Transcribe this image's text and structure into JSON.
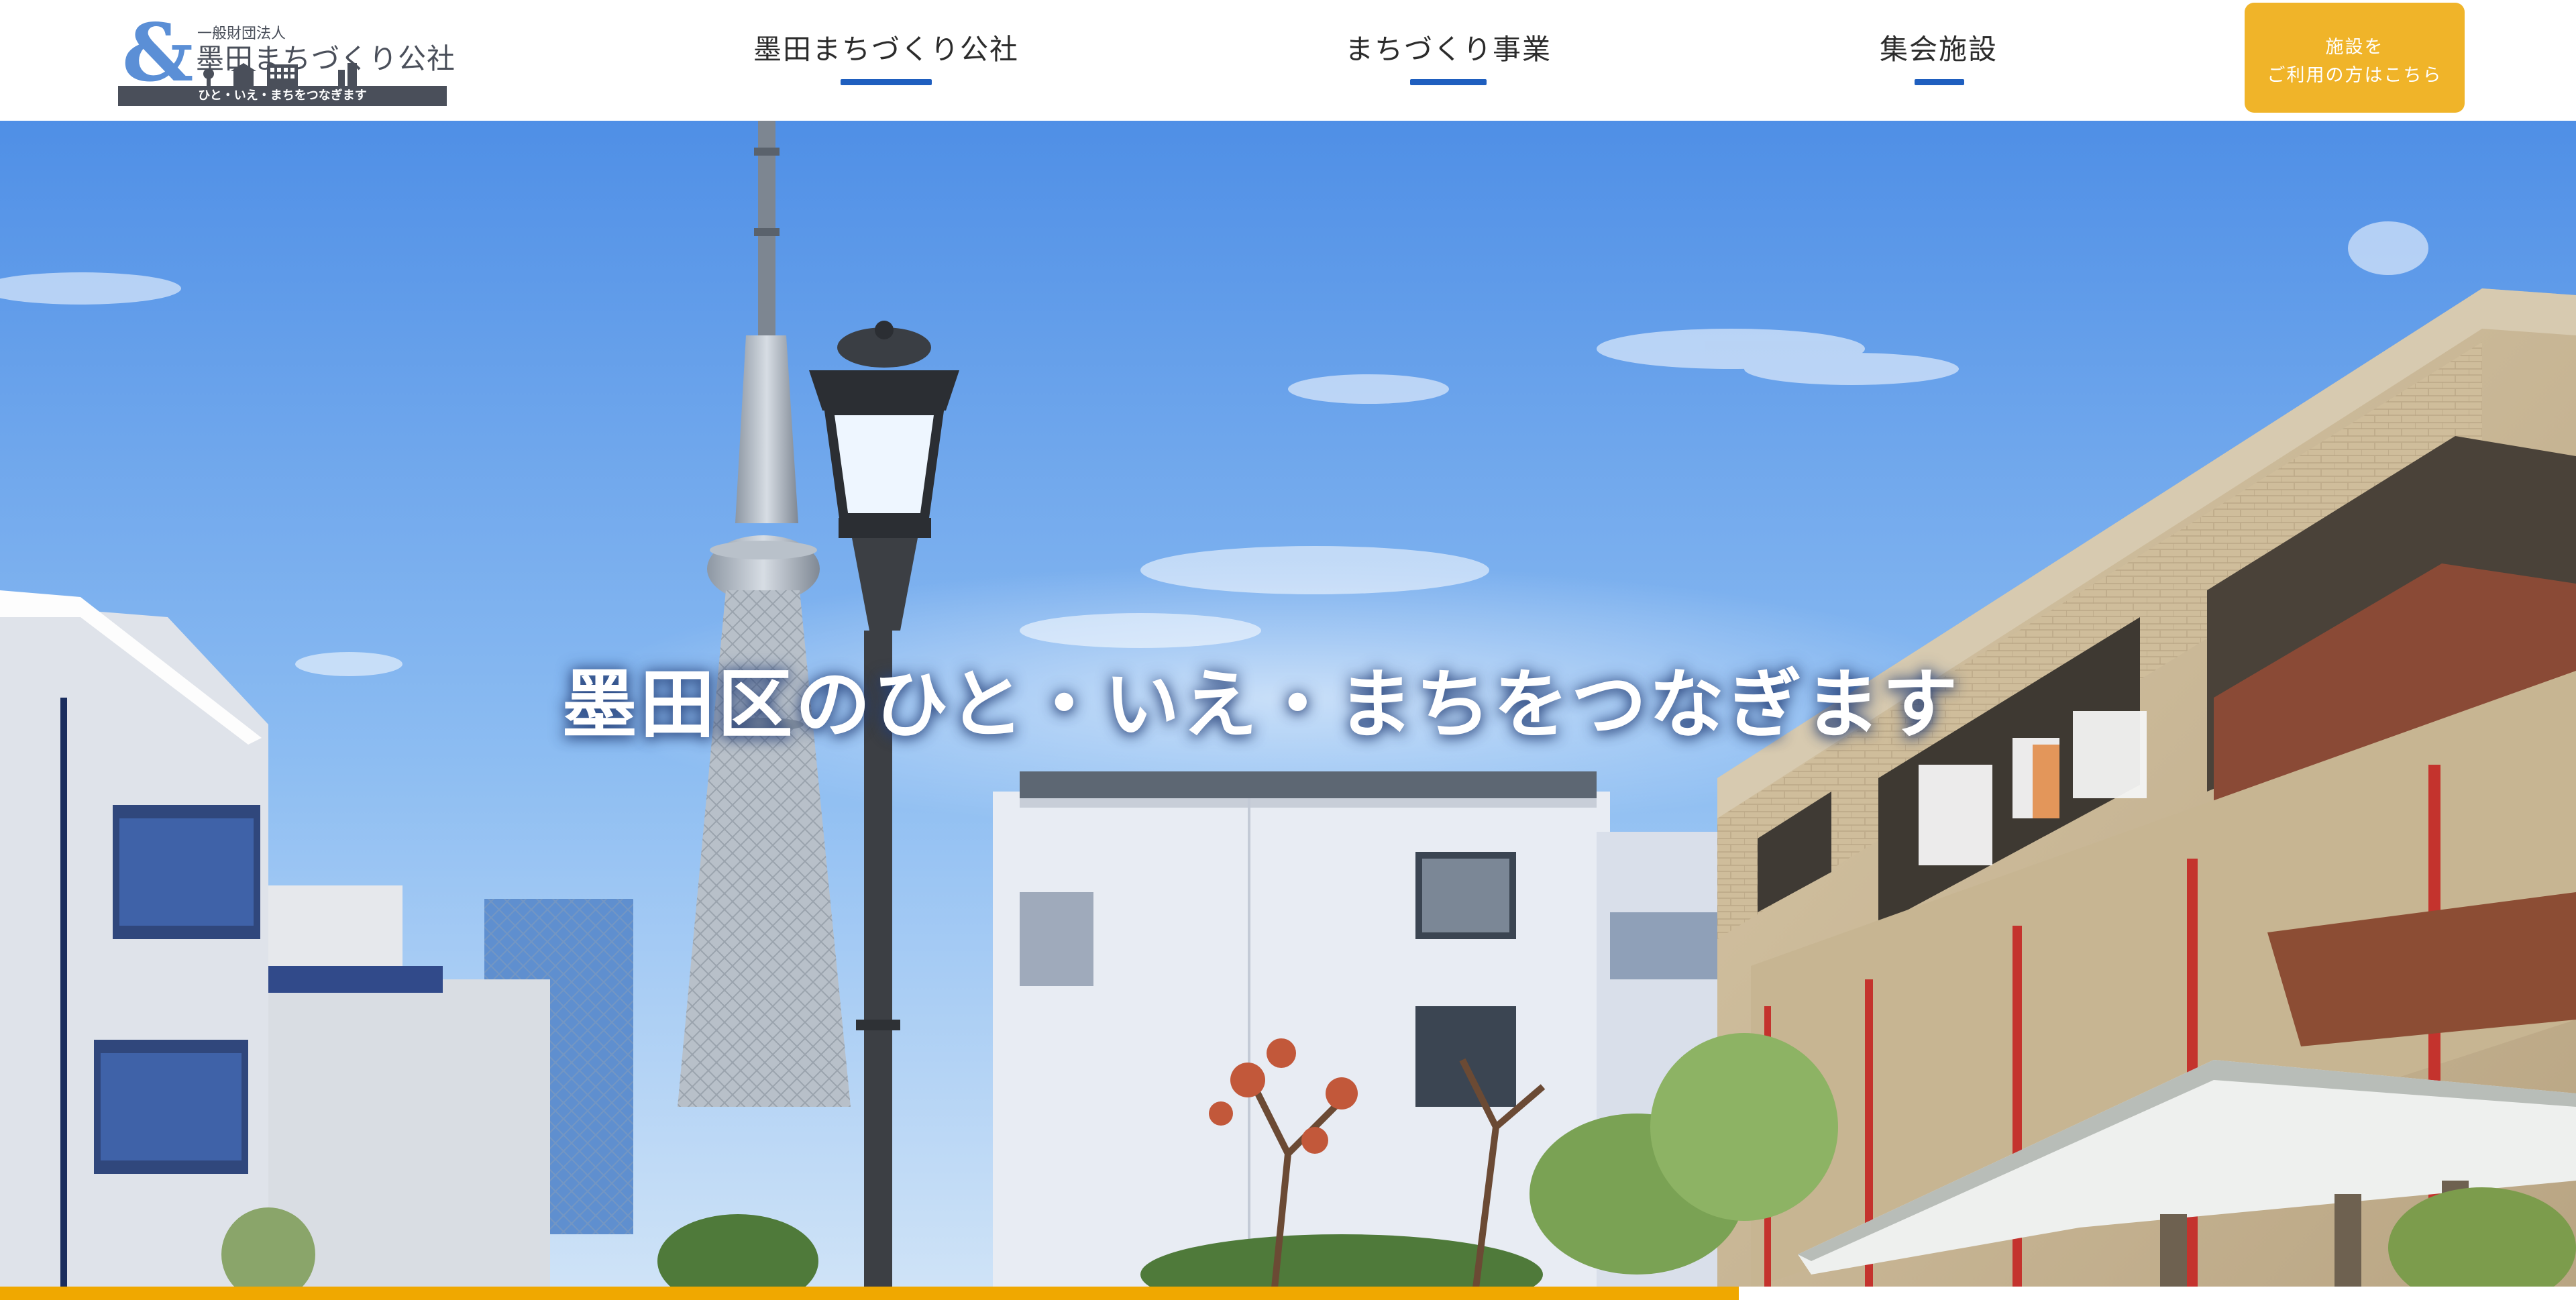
{
  "header": {
    "logo": {
      "ampersand": "&",
      "subtitle": "一般財団法人",
      "name": "墨田まちづくり公社",
      "tagline": "ひと・いえ・まちをつなぎます"
    },
    "nav": [
      {
        "label": "墨田まちづくり公社"
      },
      {
        "label": "まちづくり事業"
      },
      {
        "label": "集会施設"
      }
    ],
    "cta": {
      "line1": "施設を",
      "line2": "ご利用の方はこちら"
    }
  },
  "hero": {
    "headline": "墨田区のひと・いえ・まちをつなぎます"
  },
  "slider": {
    "progress_fraction": 0.675
  },
  "colors": {
    "accent_blue": "#1f5fbf",
    "cta_yellow": "#f0b429",
    "progress_yellow": "#f0a800",
    "logo_gray": "#4a4f5a",
    "logo_blue": "#5b8fd6"
  }
}
